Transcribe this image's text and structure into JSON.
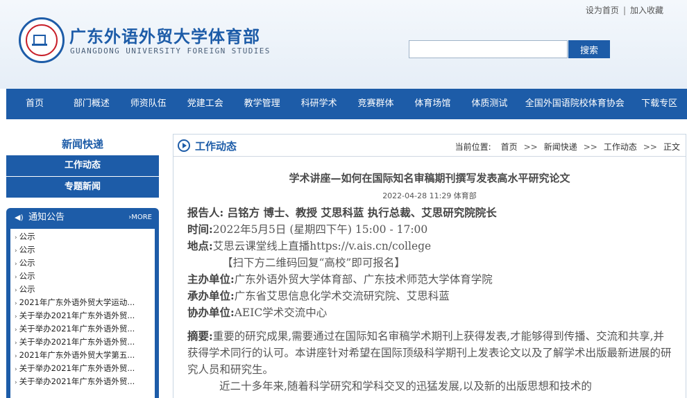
{
  "header": {
    "title": "广东外语外贸大学体育部",
    "subtitle": "GUANGDONG UNIVERSITY FOREIGN STUDIES",
    "top_links": [
      "设为首页",
      "加入收藏"
    ],
    "search_placeholder": "",
    "search_button": "搜索"
  },
  "nav": {
    "items": [
      "首页",
      "部门概述",
      "师资队伍",
      "党建工会",
      "教学管理",
      "科研学术",
      "竞赛群体",
      "体育场馆",
      "体质测试",
      "全国外国语院校体育协会",
      "下载专区"
    ]
  },
  "sidebar": {
    "title": "新闻快递",
    "items": [
      "工作动态",
      "专题新闻"
    ]
  },
  "notice": {
    "title": "通知公告",
    "more": "MORE",
    "items": [
      "公示",
      "公示",
      "公示",
      "公示",
      "公示",
      "2021年广东外语外贸大学运动...",
      "关于举办2021年广东外语外贸...",
      "关于举办2021年广东外语外贸...",
      "关于举办2021年广东外语外贸...",
      "2021年广东外语外贸大学第五...",
      "关于举办2021年广东外语外贸...",
      "关于举办2021年广东外语外贸..."
    ]
  },
  "main": {
    "title": "工作动态",
    "breadcrumb": {
      "label": "当前位置:",
      "items": [
        "首页",
        "新闻快递",
        "工作动态",
        "正文"
      ],
      "separator": ">>"
    }
  },
  "article": {
    "title": "学术讲座—如何在国际知名审稿期刊撰写发表高水平研究论文",
    "meta": "2022-04-28 11:29 体育部",
    "speaker": "报告人: 吕铭方 博士、教授 艾思科蓝 执行总裁、艾思研究院院长",
    "time_label": "时间:",
    "time_value": "2022年5月5日 (星期四下午) 15:00 - 17:00",
    "place_label": "地点:",
    "place_value": "艾思云课堂线上直播https://v.ais.cn/college",
    "place_note": "【扫下方二维码回复“高校”即可报名】",
    "host_label": "主办单位:",
    "host_value": "广东外语外贸大学体育部、广东技术师范大学体育学院",
    "organizer_label": "承办单位:",
    "organizer_value": "广东省艾思信息化学术交流研究院、艾思科蓝",
    "co_label": "协办单位:",
    "co_value": "AEIC学术交流中心",
    "abstract_label": "摘要:",
    "abstract_value": "重要的研究成果,需要通过在国际知名审稿学术期刊上获得发表,才能够得到传播、交流和共享,并获得学术同行的认可。本讲座针对希望在国际顶级科学期刊上发表论文以及了解学术出版最新进展的研究人员和研究生。",
    "para2": "近二十多年来,随着科学研究和学科交叉的迅猛发展,以及新的出版思想和技术的"
  }
}
